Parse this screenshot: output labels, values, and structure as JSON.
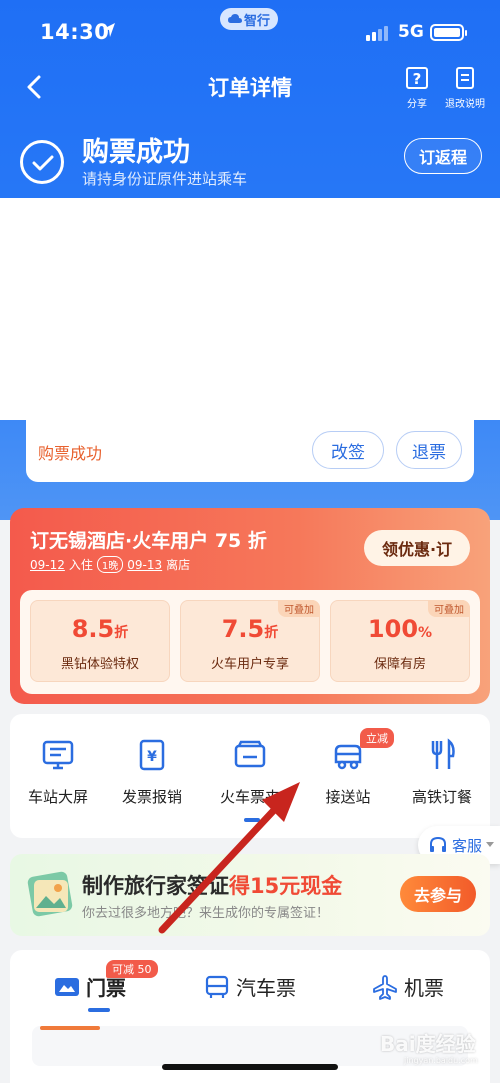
{
  "status_bar": {
    "time": "14:30",
    "app_pill": "智行",
    "network": "5G"
  },
  "nav": {
    "title": "订单详情",
    "share": "分享",
    "refund_rules": "退改说明"
  },
  "success": {
    "title": "购票成功",
    "subtitle": "请持身份证原件进站乘车",
    "return_button": "订返程"
  },
  "ticket": {
    "status": "购票成功",
    "change_button": "改签",
    "refund_button": "退票"
  },
  "hotel": {
    "title": "订无锡酒店·火车用户 75 折",
    "checkin_date": "09-12",
    "checkin_label": "入住",
    "nights": "1晚",
    "checkout_date": "09-13",
    "checkout_label": "离店",
    "coupon_button": "领优惠·订",
    "coupons": [
      {
        "value": "8.5",
        "unit": "折",
        "label": "黑钻体验特权",
        "tag": ""
      },
      {
        "value": "7.5",
        "unit": "折",
        "label": "火车用户专享",
        "tag": "可叠加"
      },
      {
        "value": "100",
        "unit": "%",
        "label": "保障有房",
        "tag": "可叠加"
      }
    ]
  },
  "services": {
    "items": [
      {
        "label": "车站大屏",
        "icon": "station-screen-icon"
      },
      {
        "label": "发票报销",
        "icon": "invoice-icon"
      },
      {
        "label": "火车票夹",
        "icon": "ticket-wallet-icon"
      },
      {
        "label": "接送站",
        "icon": "shuttle-icon"
      },
      {
        "label": "高铁订餐",
        "icon": "meal-icon"
      }
    ],
    "badge": "立减"
  },
  "customer_service": "客服",
  "visa": {
    "title_prefix": "制作旅行家签证",
    "title_highlight": "得15元现金",
    "subtitle": "你去过很多地方吧？来生成你的专属签证！",
    "button": "去参与"
  },
  "tabs": {
    "items": [
      {
        "label": "门票",
        "icon": "ticket-icon"
      },
      {
        "label": "汽车票",
        "icon": "bus-icon"
      },
      {
        "label": "机票",
        "icon": "plane-icon"
      }
    ],
    "badge": "可减 50"
  },
  "watermark": {
    "text": "Bai度经验",
    "sub": "jingyan.baidu.com"
  },
  "colors": {
    "primary": "#2b6de0",
    "header_blue": "#1f6ff5",
    "accent_red": "#f04a35",
    "orange": "#f25b2a"
  }
}
